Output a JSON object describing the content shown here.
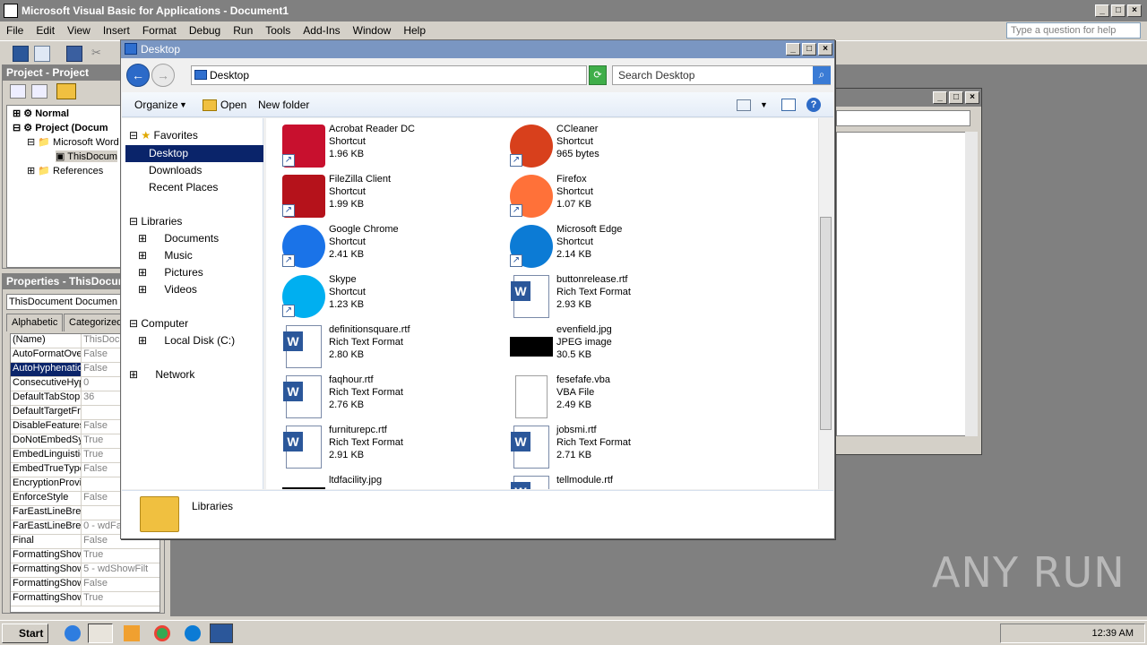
{
  "vba": {
    "title": "Microsoft Visual Basic for Applications - Document1",
    "menu": [
      "File",
      "Edit",
      "View",
      "Insert",
      "Format",
      "Debug",
      "Run",
      "Tools",
      "Add-Ins",
      "Window",
      "Help"
    ],
    "ask_placeholder": "Type a question for help",
    "project_pane_title": "Project - Project",
    "tree": [
      "Normal",
      "Project (Docum",
      "Microsoft Word",
      "ThisDocum",
      "References"
    ],
    "properties_title": "Properties - ThisDocum",
    "properties_object": "ThisDocument  Documen",
    "tabs": [
      "Alphabetic",
      "Categorized"
    ],
    "properties": [
      {
        "name": "(Name)",
        "value": "ThisDocu"
      },
      {
        "name": "AutoFormatOve",
        "value": "False"
      },
      {
        "name": "AutoHyphenatio",
        "value": "False"
      },
      {
        "name": "ConsecutiveHyp",
        "value": "0"
      },
      {
        "name": "DefaultTabStop",
        "value": "36"
      },
      {
        "name": "DefaultTargetFr",
        "value": ""
      },
      {
        "name": "DisableFeatures",
        "value": "False"
      },
      {
        "name": "DoNotEmbedSys",
        "value": "True"
      },
      {
        "name": "EmbedLinguistic",
        "value": "True"
      },
      {
        "name": "EmbedTrueType",
        "value": "False"
      },
      {
        "name": "EncryptionProvic",
        "value": ""
      },
      {
        "name": "EnforceStyle",
        "value": "False"
      },
      {
        "name": "FarEastLineBrea",
        "value": ""
      },
      {
        "name": "FarEastLineBrea",
        "value": "0 - wdFa"
      },
      {
        "name": "Final",
        "value": "False"
      },
      {
        "name": "FormattingShow",
        "value": "True"
      },
      {
        "name": "FormattingShow",
        "value": "5 - wdShowFilt"
      },
      {
        "name": "FormattingShow",
        "value": "False"
      },
      {
        "name": "FormattingShow",
        "value": "True"
      }
    ]
  },
  "explorer": {
    "title": "Desktop",
    "address": "Desktop",
    "search_placeholder": "Search Desktop",
    "commands": {
      "organize": "Organize",
      "open": "Open",
      "new_folder": "New folder"
    },
    "nav": {
      "favorites": "Favorites",
      "desktop": "Desktop",
      "downloads": "Downloads",
      "recent": "Recent Places",
      "libraries": "Libraries",
      "documents": "Documents",
      "music": "Music",
      "pictures": "Pictures",
      "videos": "Videos",
      "computer": "Computer",
      "local_disk": "Local Disk (C:)",
      "network": "Network"
    },
    "files": [
      {
        "name": "Acrobat Reader DC",
        "type": "Shortcut",
        "size": "1.96 KB",
        "icon": "acrobat-icon",
        "color": "#c8102e"
      },
      {
        "name": "CCleaner",
        "type": "Shortcut",
        "size": "965 bytes",
        "icon": "ccleaner-icon",
        "color": "#d8401c"
      },
      {
        "name": "FileZilla Client",
        "type": "Shortcut",
        "size": "1.99 KB",
        "icon": "filezilla-icon",
        "color": "#b5121b"
      },
      {
        "name": "Firefox",
        "type": "Shortcut",
        "size": "1.07 KB",
        "icon": "firefox-icon",
        "color": "#ff7139"
      },
      {
        "name": "Google Chrome",
        "type": "Shortcut",
        "size": "2.41 KB",
        "icon": "chrome-icon",
        "color": "#1a73e8"
      },
      {
        "name": "Microsoft Edge",
        "type": "Shortcut",
        "size": "2.14 KB",
        "icon": "edge-icon",
        "color": "#0c7bd5"
      },
      {
        "name": "Skype",
        "type": "Shortcut",
        "size": "1.23 KB",
        "icon": "skype-icon",
        "color": "#00aff0"
      },
      {
        "name": "buttonrelease.rtf",
        "type": "Rich Text Format",
        "size": "2.93 KB",
        "icon": "word-doc-icon",
        "color": "#2b579a"
      },
      {
        "name": "definitionsquare.rtf",
        "type": "Rich Text Format",
        "size": "2.80 KB",
        "icon": "word-doc-icon",
        "color": "#2b579a"
      },
      {
        "name": "evenfield.jpg",
        "type": "JPEG image",
        "size": "30.5 KB",
        "icon": "image-thumb-icon",
        "color": "#000000"
      },
      {
        "name": "faqhour.rtf",
        "type": "Rich Text Format",
        "size": "2.76 KB",
        "icon": "word-doc-icon",
        "color": "#2b579a"
      },
      {
        "name": "fesefafe.vba",
        "type": "VBA File",
        "size": "2.49 KB",
        "icon": "blank-file-icon",
        "color": "#ffffff"
      },
      {
        "name": "furniturepc.rtf",
        "type": "Rich Text Format",
        "size": "2.91 KB",
        "icon": "word-doc-icon",
        "color": "#2b579a"
      },
      {
        "name": "jobsmi.rtf",
        "type": "Rich Text Format",
        "size": "2.71 KB",
        "icon": "word-doc-icon",
        "color": "#2b579a"
      },
      {
        "name": "ltdfacility.jpg",
        "type": "",
        "size": "",
        "icon": "image-thumb-icon",
        "color": "#000000"
      },
      {
        "name": "tellmodule.rtf",
        "type": "",
        "size": "",
        "icon": "word-doc-icon",
        "color": "#2b579a"
      }
    ],
    "details_label": "Libraries"
  },
  "taskbar": {
    "start": "Start",
    "clock": "12:39 AM"
  },
  "watermark": "ANY RUN"
}
